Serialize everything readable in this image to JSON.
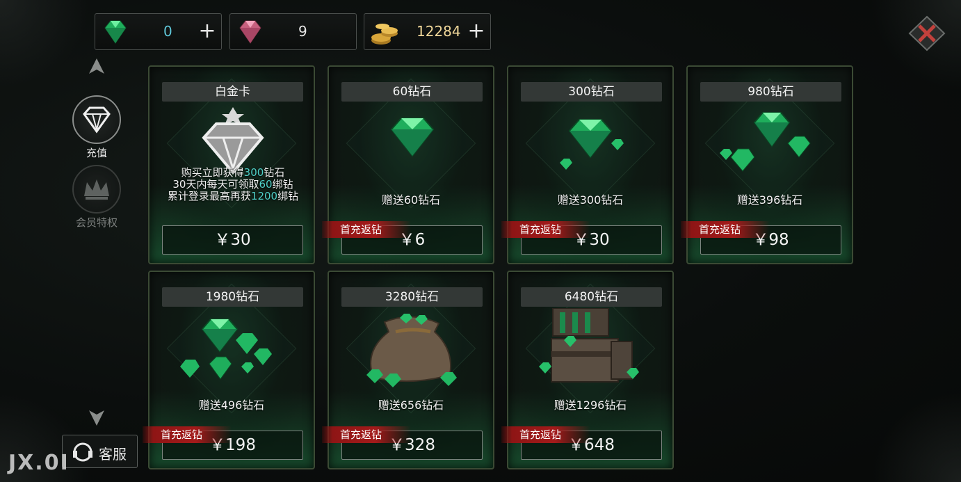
{
  "currencies": [
    {
      "icon": "green-diamond-icon",
      "value": "0"
    },
    {
      "icon": "pink-diamond-icon",
      "value": "9"
    },
    {
      "icon": "gold-coin-icon",
      "value": "12284"
    }
  ],
  "plus_symbol": "+",
  "nav": {
    "recharge_label": "充值",
    "vip_label": "会员特权"
  },
  "service": {
    "label": "客服"
  },
  "watermark": "JX.0I",
  "currency_symbol": "￥",
  "ribbon_label": "首充返钻",
  "cards": [
    {
      "title": "白金卡",
      "desc_lines": [
        {
          "pre": "购买立即获得",
          "hl": "300",
          "post": "钻石"
        },
        {
          "pre": "30天内每天可领取",
          "hl": "60",
          "post": "绑钻"
        },
        {
          "pre": "累计登录最高再获",
          "hl": "1200",
          "post": "绑钻"
        }
      ],
      "price": "￥30"
    },
    {
      "title": "60钻石",
      "gift": "赠送60钻石",
      "price": "￥6",
      "ribbon": "首充返钻"
    },
    {
      "title": "300钻石",
      "gift": "赠送300钻石",
      "price": "￥30",
      "ribbon": "首充返钻"
    },
    {
      "title": "980钻石",
      "gift": "赠送396钻石",
      "price": "￥98",
      "ribbon": "首充返钻"
    },
    {
      "title": "1980钻石",
      "gift": "赠送496钻石",
      "price": "￥198",
      "ribbon": "首充返钻"
    },
    {
      "title": "3280钻石",
      "gift": "赠送656钻石",
      "price": "￥328",
      "ribbon": "首充返钻"
    },
    {
      "title": "6480钻石",
      "gift": "赠送1296钻石",
      "price": "￥648",
      "ribbon": "首充返钻"
    }
  ],
  "colors": {
    "accent_teal": "#4fd0c8",
    "gem_green": "#2ec76a",
    "ribbon_red": "#a31a1a"
  }
}
